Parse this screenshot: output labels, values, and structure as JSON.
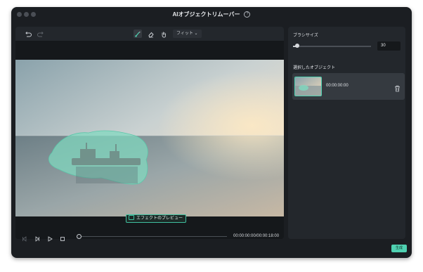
{
  "window": {
    "title": "AIオブジェクトリムーバー",
    "help_icon": "?"
  },
  "toolbar": {
    "undo_icon": "undo-icon",
    "redo_icon": "redo-icon",
    "brush_icon": "brush-icon",
    "eraser_icon": "eraser-icon",
    "hand_icon": "hand-icon",
    "fit_label": "フィット ⌄"
  },
  "preview": {
    "button_label": "エフェクトのプレビュー"
  },
  "playback": {
    "timecode": "00:00:00:00/00:00:18:00",
    "progress": 0
  },
  "panel": {
    "brush_size_label": "ブラシサイズ",
    "brush_size_value": "30",
    "brush_size_fraction": 0.05,
    "selected_objects_label": "選択したオブジェクト",
    "objects": [
      {
        "time": "00:00:00:00"
      }
    ]
  },
  "footer": {
    "generate_label": "生成"
  },
  "colors": {
    "accent": "#4fd1b1",
    "background": "#1b1e22",
    "panel": "#23272c"
  }
}
